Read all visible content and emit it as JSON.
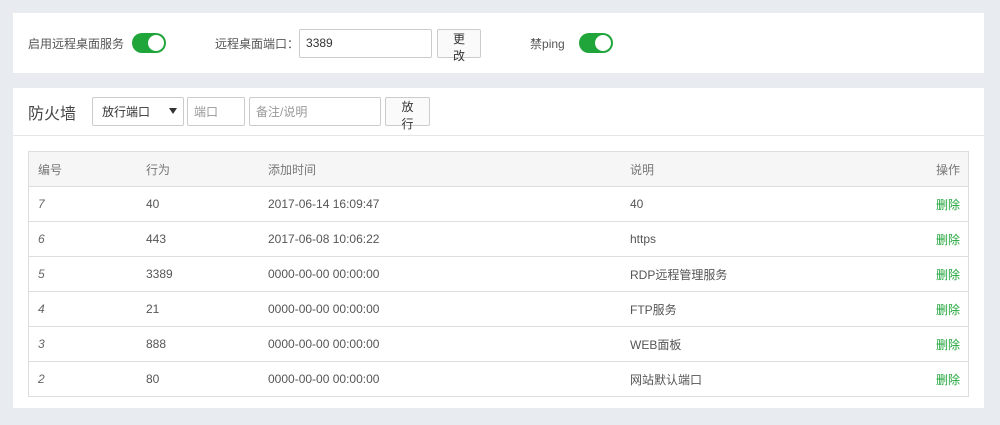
{
  "top": {
    "remote_service_label": "启用远程桌面服务",
    "remote_service_on": true,
    "port_label": "远程桌面端口：",
    "port_value": "3389",
    "change_button": "更改",
    "ping_label": "禁ping",
    "ping_on": true
  },
  "firewall": {
    "title": "防火墙",
    "action_select": "放行端口",
    "port_placeholder": "端口",
    "note_placeholder": "备注/说明",
    "allow_button": "放行",
    "table": {
      "headers": [
        "编号",
        "行为",
        "添加时间",
        "说明",
        "操作"
      ],
      "rows": [
        {
          "id": "7",
          "action": "40",
          "time": "2017-06-14 16:09:47",
          "note": "40",
          "op": "删除"
        },
        {
          "id": "6",
          "action": "443",
          "time": "2017-06-08 10:06:22",
          "note": "https",
          "op": "删除"
        },
        {
          "id": "5",
          "action": "3389",
          "time": "0000-00-00 00:00:00",
          "note": "RDP远程管理服务",
          "op": "删除"
        },
        {
          "id": "4",
          "action": "21",
          "time": "0000-00-00 00:00:00",
          "note": "FTP服务",
          "op": "删除"
        },
        {
          "id": "3",
          "action": "888",
          "time": "0000-00-00 00:00:00",
          "note": "WEB面板",
          "op": "删除"
        },
        {
          "id": "2",
          "action": "80",
          "time": "0000-00-00 00:00:00",
          "note": "网站默认端口",
          "op": "删除"
        }
      ]
    }
  },
  "colors": {
    "accent": "#20a53a",
    "background": "#e8ebef"
  }
}
